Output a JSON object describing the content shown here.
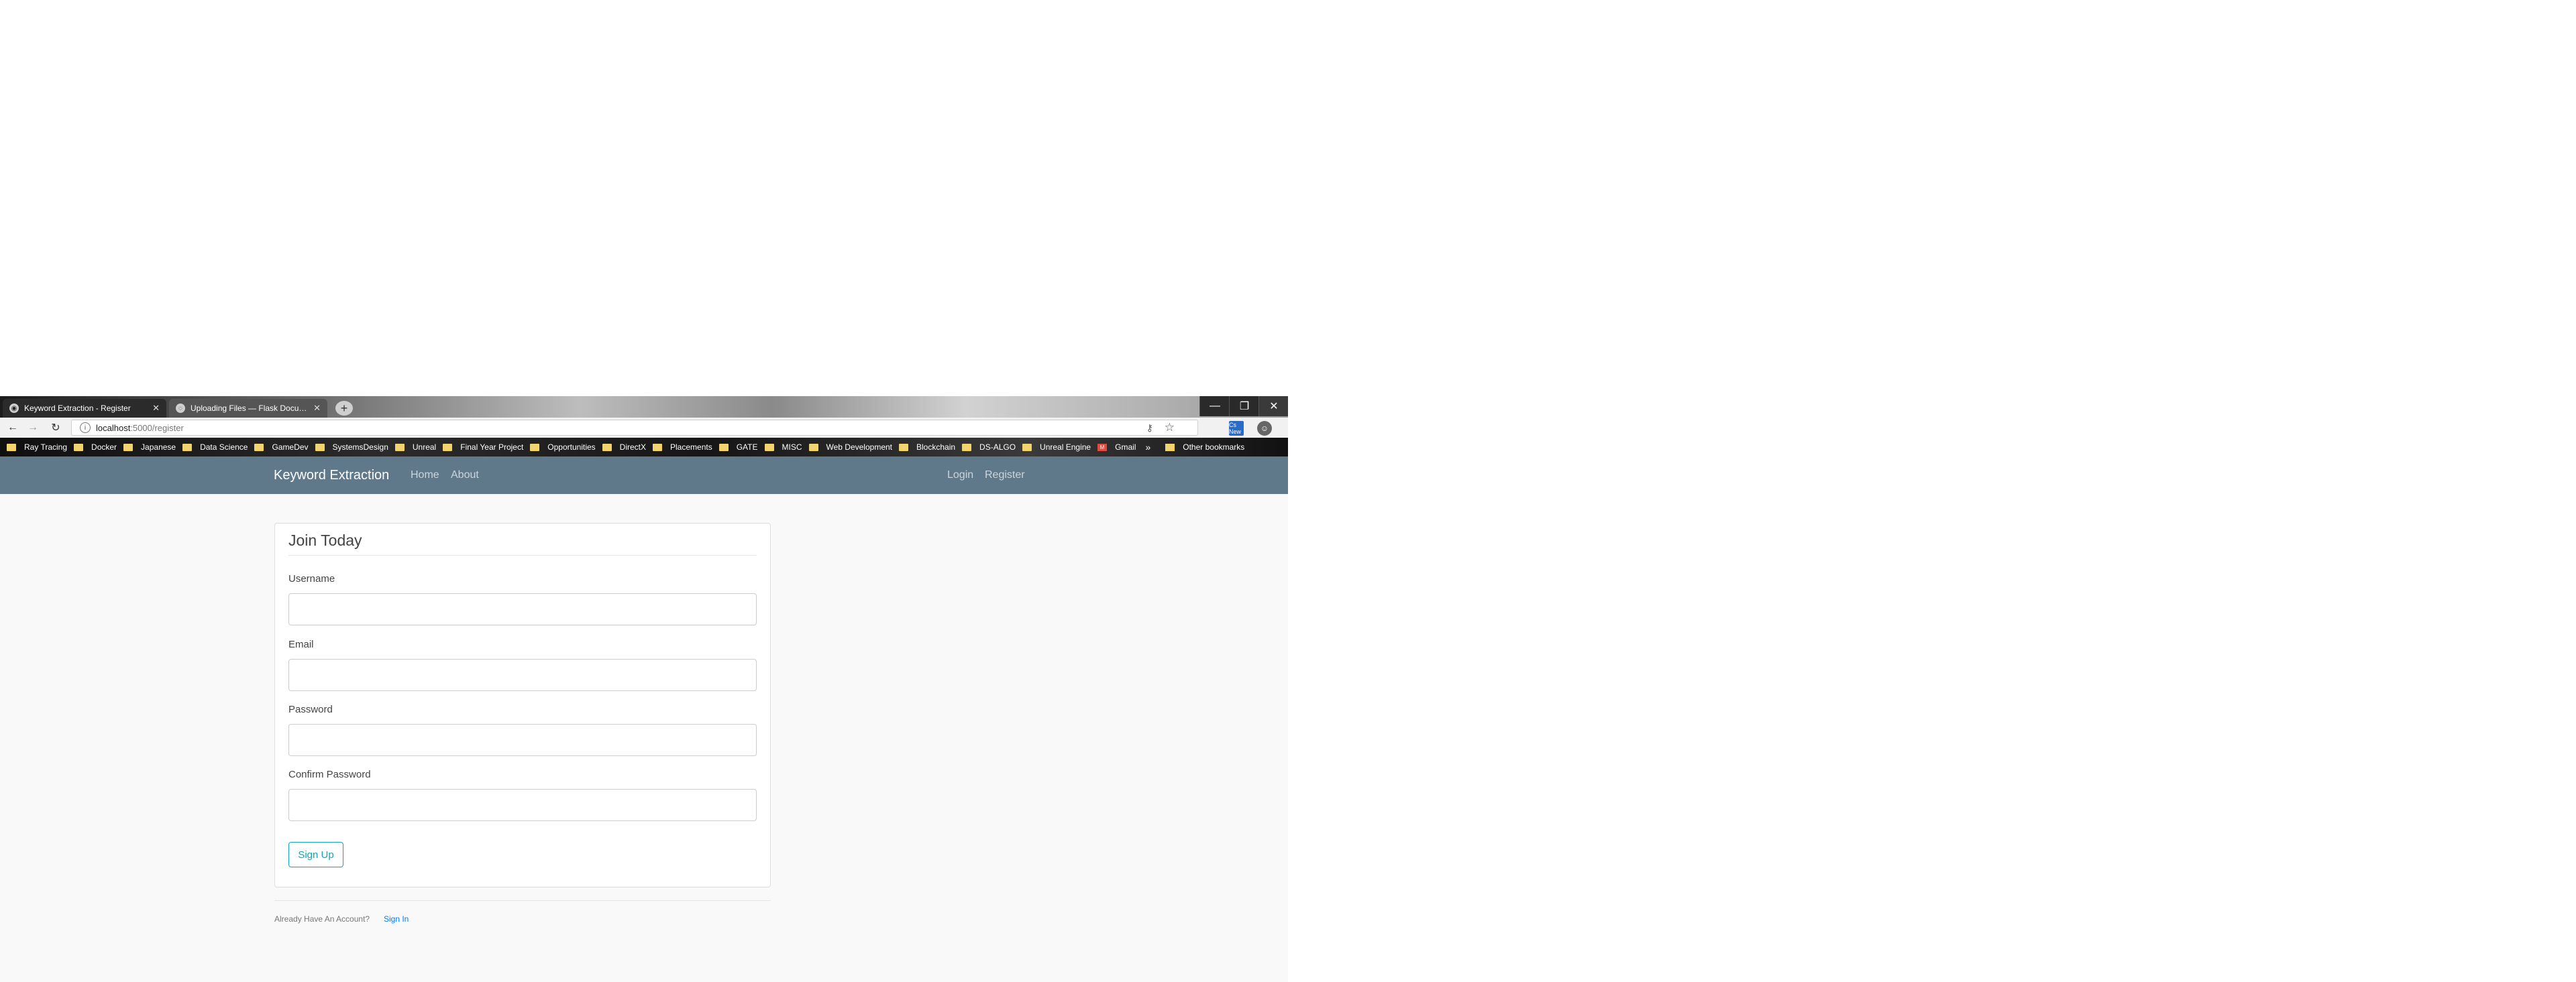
{
  "browser": {
    "tabs": [
      {
        "title": "Keyword Extraction - Register",
        "active": true
      },
      {
        "title": "Uploading Files — Flask Docum...",
        "active": false
      }
    ],
    "new_tab_icon": "+",
    "window_controls": {
      "minimize": "—",
      "maximize": "❐",
      "close": "✕"
    },
    "nav_icons": {
      "back": "←",
      "forward": "→",
      "reload": "↻"
    },
    "address": {
      "host": "localhost",
      "path": ":5000/register",
      "info_icon": "i"
    },
    "address_icons": {
      "key": "⚷",
      "star": "☆"
    },
    "extension_badge": "Cs New",
    "bookmarks": [
      "Ray Tracing",
      "Docker",
      "Japanese",
      "Data Science",
      "GameDev",
      "SystemsDesign",
      "Unreal",
      "Final Year Project",
      "Opportunities",
      "DirectX",
      "Placements",
      "GATE",
      "MISC",
      "Web Development",
      "Blockchain",
      "DS-ALGO",
      "Unreal Engine"
    ],
    "gmail_bookmark": "Gmail",
    "more_bookmarks": "»",
    "other_bookmarks": "Other bookmarks"
  },
  "site": {
    "brand": "Keyword Extraction",
    "nav_left": {
      "home": "Home",
      "about": "About"
    },
    "nav_right": {
      "login": "Login",
      "register": "Register"
    }
  },
  "form": {
    "legend": "Join Today",
    "fields": {
      "username": {
        "label": "Username",
        "value": ""
      },
      "email": {
        "label": "Email",
        "value": ""
      },
      "password": {
        "label": "Password",
        "value": ""
      },
      "confirm_password": {
        "label": "Confirm Password",
        "value": ""
      }
    },
    "submit_label": "Sign Up"
  },
  "footer": {
    "prompt": "Already Have An Account?",
    "link": "Sign In"
  },
  "colors": {
    "navbar": "#5f788a",
    "button_accent": "#17a2b8",
    "link": "#007bff"
  }
}
